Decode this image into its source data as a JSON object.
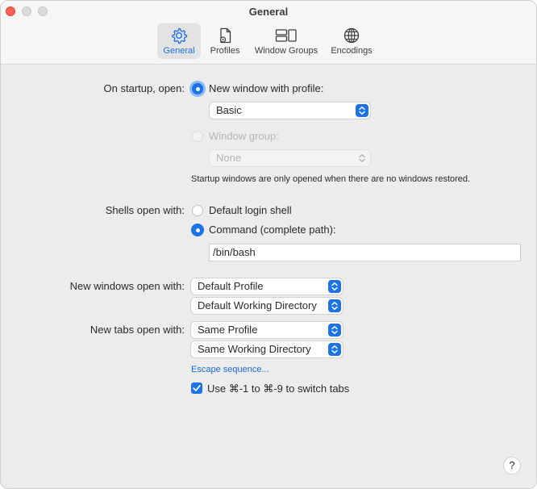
{
  "window": {
    "title": "General"
  },
  "tabs": [
    {
      "label": "General",
      "icon": "gear-icon",
      "active": true
    },
    {
      "label": "Profiles",
      "icon": "profile-document-icon",
      "active": false
    },
    {
      "label": "Window Groups",
      "icon": "window-groups-icon",
      "active": false
    },
    {
      "label": "Encodings",
      "icon": "globe-icon",
      "active": false
    }
  ],
  "startup": {
    "label": "On startup, open:",
    "option_profile": "New window with profile:",
    "profile_value": "Basic",
    "option_group": "Window group:",
    "group_value": "None",
    "note": "Startup windows are only opened when there are no windows restored."
  },
  "shells": {
    "label": "Shells open with:",
    "option_default": "Default login shell",
    "option_command": "Command (complete path):",
    "command_value": "/bin/bash"
  },
  "new_windows": {
    "label": "New windows open with:",
    "profile": "Default Profile",
    "directory": "Default Working Directory"
  },
  "new_tabs": {
    "label": "New tabs open with:",
    "profile": "Same Profile",
    "directory": "Same Working Directory"
  },
  "escape_link": "Escape sequence...",
  "switch_tabs": {
    "label": "Use ⌘-1 to ⌘-9 to switch tabs",
    "checked": true
  },
  "help": "?",
  "colors": {
    "accent": "#1b73ea",
    "close": "#ff5f57"
  }
}
